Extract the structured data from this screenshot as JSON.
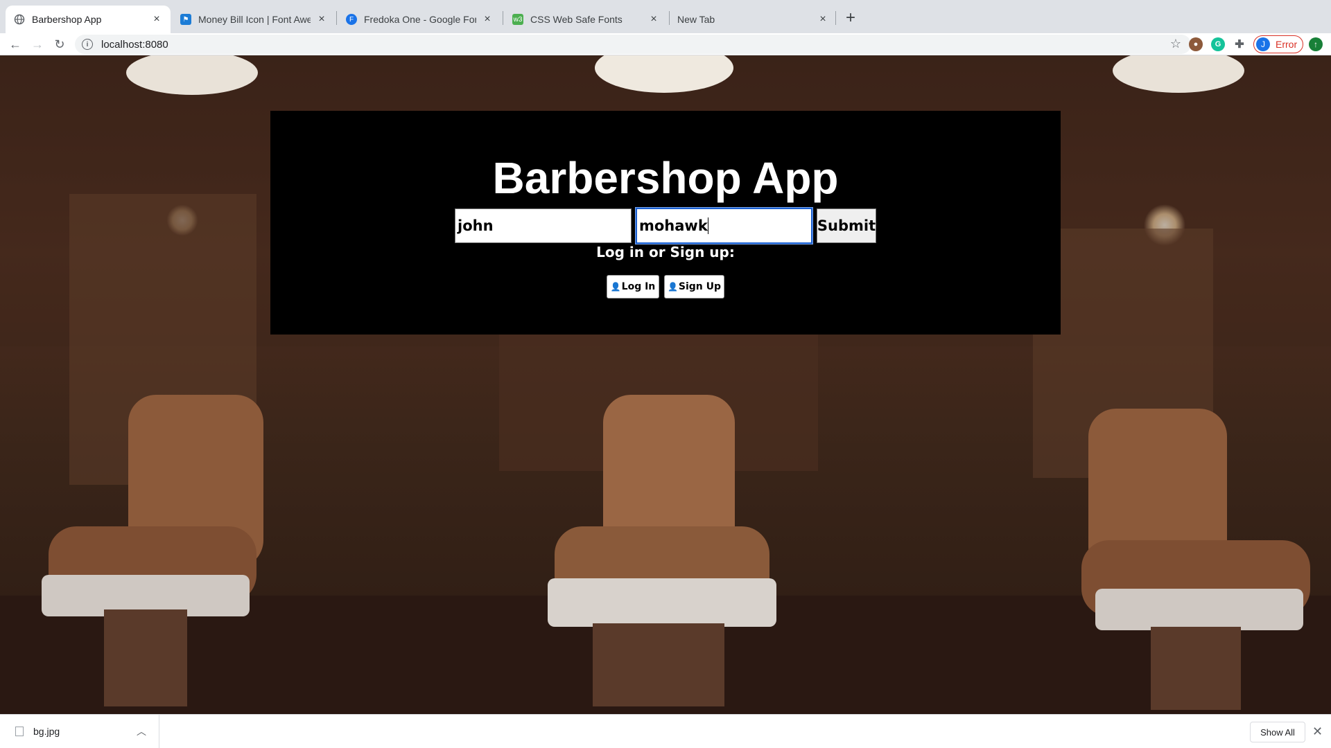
{
  "browser": {
    "tabs": [
      {
        "title": "Barbershop App",
        "favicon": "globe-icon"
      },
      {
        "title": "Money Bill Icon | Font Awesome",
        "favicon": "font-awesome-flag-icon"
      },
      {
        "title": "Fredoka One - Google Fonts",
        "favicon": "google-fonts-icon"
      },
      {
        "title": "CSS Web Safe Fonts",
        "favicon": "w3schools-icon"
      },
      {
        "title": "New Tab",
        "favicon": ""
      }
    ],
    "url": "localhost:8080",
    "profile_initial": "J",
    "profile_status": "Error",
    "colors": {
      "accent": "#1a73e8",
      "error": "#d93025"
    }
  },
  "app": {
    "title": "Barbershop App",
    "username_value": "john",
    "password_value": "mohawk",
    "submit_label": "Submit",
    "prompt": "Log in or Sign up:",
    "login_label": "Log In",
    "signup_label": "Sign Up"
  },
  "downloads": {
    "file_name": "bg.jpg",
    "show_all_label": "Show All"
  }
}
